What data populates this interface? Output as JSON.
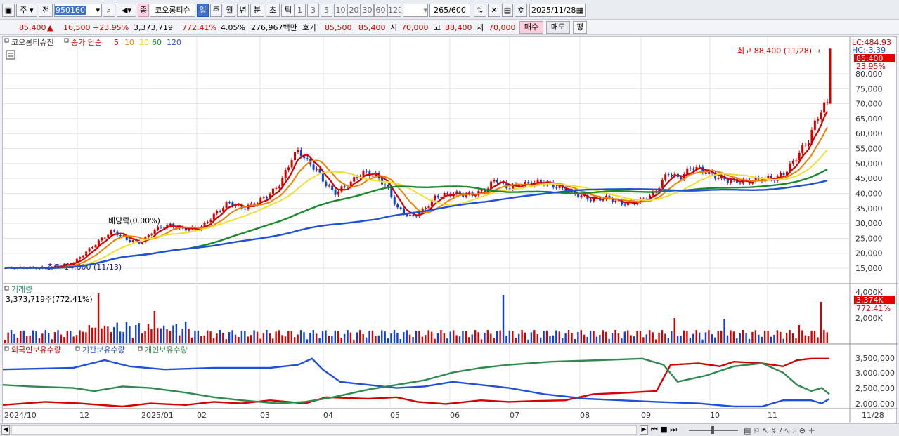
{
  "toolbar": {
    "type_label": "주",
    "prev_label": "전",
    "code": "950160",
    "stock_name": "코오롱티슈",
    "period_selected": "일",
    "periods": [
      "주",
      "월",
      "년",
      "분",
      "초",
      "틱"
    ],
    "minute_values": [
      "1",
      "3",
      "5",
      "10",
      "20",
      "30",
      "60",
      "120"
    ],
    "count": "265",
    "count_max": "/600",
    "date": "2025/11/28",
    "jong_label": "종"
  },
  "quote": {
    "price": "85,400",
    "arrow": "▲",
    "change": "16,500",
    "change_pct": "+23.95%",
    "volume": "3,373,719",
    "vol_ratio": "772.41%",
    "turnover": "4.05%",
    "amount": "276,967백만",
    "hoga_label": "호가",
    "ask": "85,500",
    "bid": "85,400",
    "open_label": "시",
    "open": "70,000",
    "high_label": "고",
    "high": "88,400",
    "low_label": "저",
    "low": "70,000",
    "buy_label": "매수",
    "sell_label": "매도",
    "avg_label": "평"
  },
  "price_panel": {
    "title": "코오롱티슈진",
    "legend_prefix": "종가 단순",
    "ma": [
      {
        "label": "5",
        "color": "#d40000"
      },
      {
        "label": "10",
        "color": "#f08000"
      },
      {
        "label": "20",
        "color": "#e8d800"
      },
      {
        "label": "60",
        "color": "#1a8a2a"
      },
      {
        "label": "120",
        "color": "#2050d8"
      }
    ],
    "lc": "LC:484.93",
    "hc": "HC:-3.39",
    "last_price": "85,400",
    "last_pct": "23.95%",
    "high_note": "최고 88,400 (11/28) →",
    "low_note": "←최저 14,600 (11/13)",
    "div_note": "배당락(0.00%)",
    "yticks": [
      "80,000",
      "75,000",
      "70,000",
      "65,000",
      "60,000",
      "55,000",
      "50,000",
      "45,000",
      "40,000",
      "35,000",
      "30,000",
      "25,000",
      "20,000",
      "15,000"
    ]
  },
  "volume_panel": {
    "title": "거래량",
    "value": "3,373,719주(772.41%)",
    "yticks": [
      "4,000K",
      "2,000K"
    ],
    "last_vol": "3,374K",
    "last_pct": "772.41%"
  },
  "holdings_panel": {
    "series": [
      {
        "label": "외국인보유수량",
        "color": "#d40000"
      },
      {
        "label": "기관보유수량",
        "color": "#2050d8"
      },
      {
        "label": "개인보유수량",
        "color": "#2e8a4e"
      }
    ],
    "yticks": [
      "3,500,000",
      "3,000,000",
      "2,500,000",
      "2,000,000"
    ]
  },
  "xaxis": [
    "2024/10",
    "12",
    "2025/01",
    "02",
    "03",
    "04",
    "05",
    "06",
    "07",
    "08",
    "09",
    "10",
    "11",
    "11/28"
  ],
  "colors": {
    "up": "#d40000",
    "down": "#1040d0",
    "accent": "#3b6fd0"
  }
}
